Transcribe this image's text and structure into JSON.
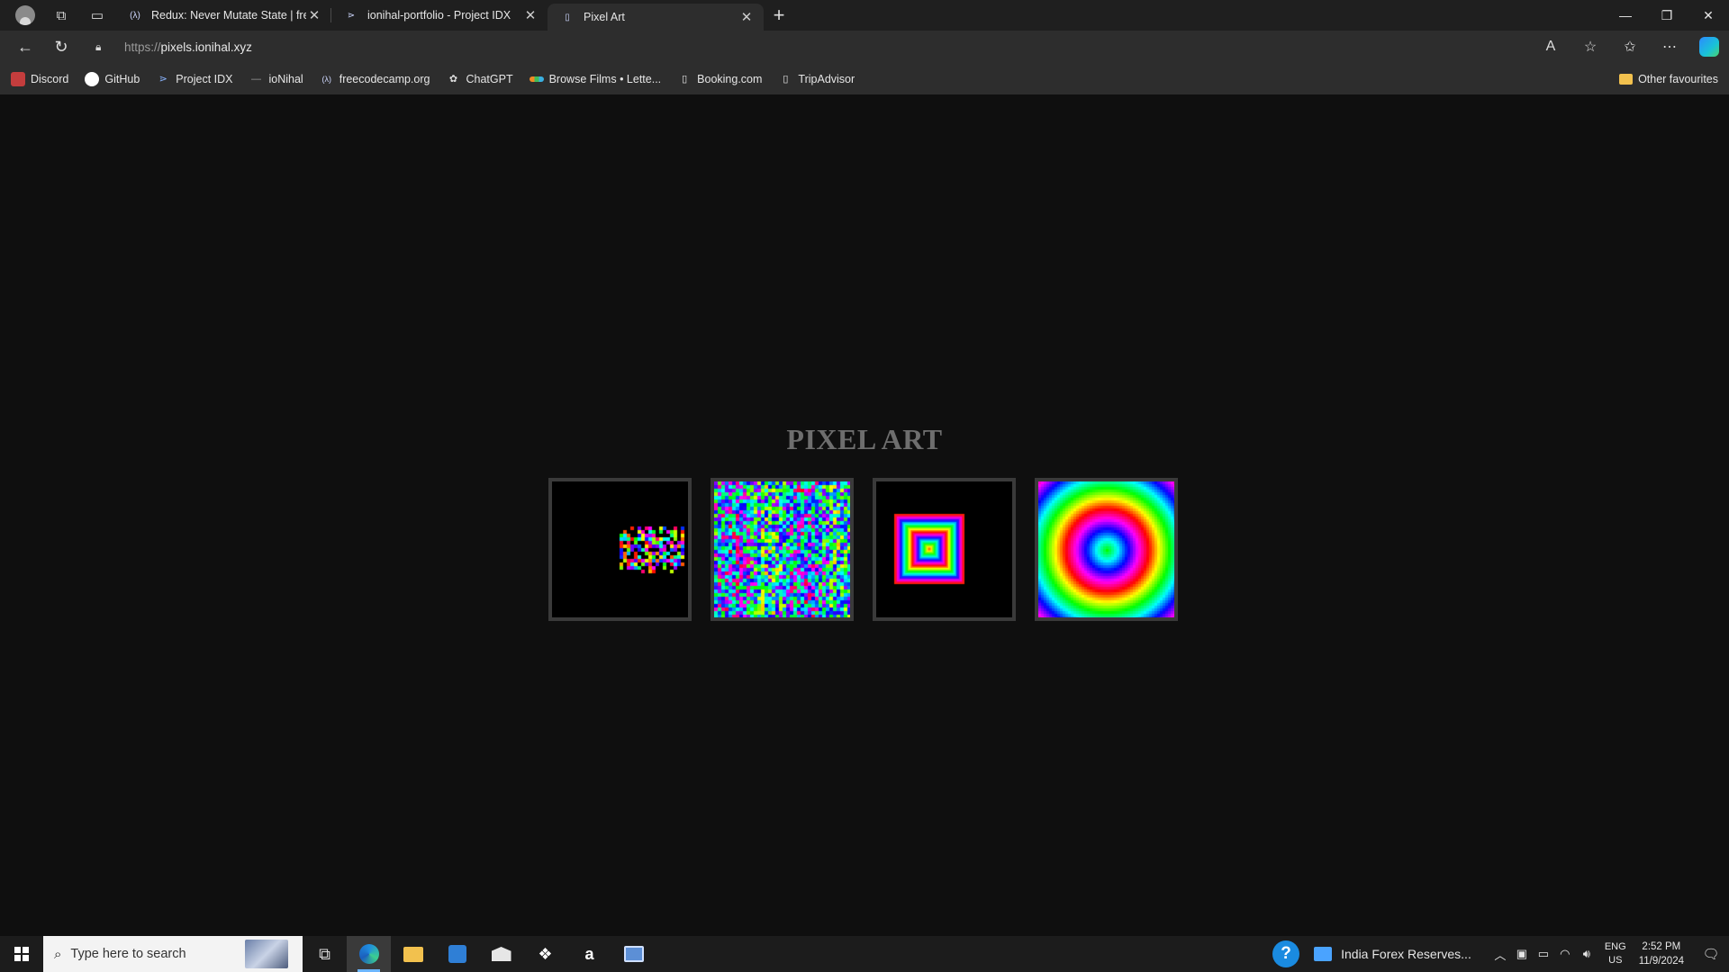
{
  "browser": {
    "tabs": [
      {
        "title": "Redux: Never Mutate State | freeC",
        "icon": "freecodecamp-icon",
        "active": false
      },
      {
        "title": "ionihal-portfolio - Project IDX",
        "icon": "project-idx-icon",
        "active": false
      },
      {
        "title": "Pixel Art",
        "icon": "page-icon",
        "active": true
      }
    ],
    "address": {
      "protocol": "https://",
      "host": "pixels.ionihal.xyz"
    },
    "bookmarks": [
      {
        "label": "Discord",
        "icon": "discord-icon"
      },
      {
        "label": "GitHub",
        "icon": "github-icon"
      },
      {
        "label": "Project IDX",
        "icon": "project-idx-icon"
      },
      {
        "label": "ioNihal",
        "icon": "dash-icon"
      },
      {
        "label": "freecodecamp.org",
        "icon": "freecodecamp-icon"
      },
      {
        "label": "ChatGPT",
        "icon": "chatgpt-icon"
      },
      {
        "label": "Browse Films • Lette...",
        "icon": "letterboxd-icon"
      },
      {
        "label": "Booking.com",
        "icon": "page-icon"
      },
      {
        "label": "TripAdvisor",
        "icon": "page-icon"
      }
    ],
    "other_favourites": "Other favourites"
  },
  "page": {
    "title": "PIXEL ART",
    "artworks": [
      {
        "name": "pixel-art-scatter",
        "style": "scatter"
      },
      {
        "name": "pixel-art-noise",
        "style": "noise"
      },
      {
        "name": "pixel-art-squares",
        "style": "squares"
      },
      {
        "name": "pixel-art-rings",
        "style": "rings"
      }
    ]
  },
  "taskbar": {
    "search_placeholder": "Type here to search",
    "news": "India Forex Reserves...",
    "lang_top": "ENG",
    "lang_bottom": "US",
    "time": "2:52 PM",
    "date": "11/9/2024"
  }
}
